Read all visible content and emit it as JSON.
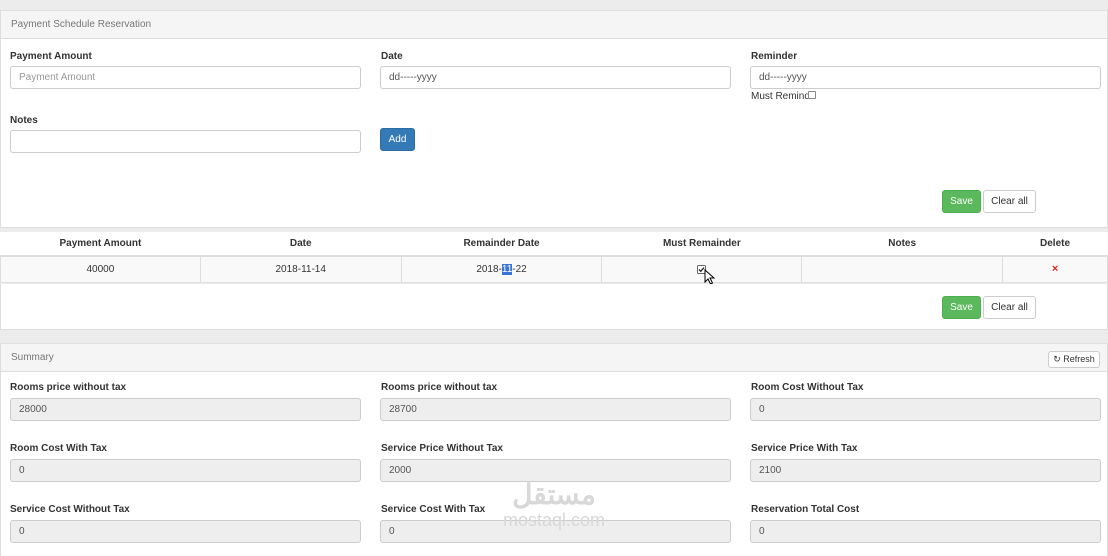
{
  "schedule": {
    "title": "Payment Schedule Reservation",
    "payment_amount_label": "Payment Amount",
    "payment_amount_placeholder": "Payment Amount",
    "date_label": "Date",
    "date_placeholder": "dd-----yyyy",
    "reminder_label": "Reminder",
    "reminder_placeholder": "dd-----yyyy",
    "must_remind_label": "Must Remind",
    "notes_label": "Notes",
    "notes_value": "",
    "add_label": "Add",
    "save_label": "Save",
    "clear_label": "Clear all"
  },
  "table": {
    "headers": [
      "Payment Amount",
      "Date",
      "Remainder Date",
      "Must Remainder",
      "Notes",
      "Delete"
    ],
    "rows": [
      {
        "amount": "40000",
        "date": "2018-11-14",
        "remainder_pre": "2018-",
        "remainder_sel": "11",
        "remainder_post": "-22",
        "must_remainder": true,
        "notes": "",
        "delete_icon": "×"
      }
    ]
  },
  "bottom_actions": {
    "save_label": "Save",
    "clear_label": "Clear all"
  },
  "summary": {
    "title": "Summary",
    "refresh_label": "Refresh",
    "fields": [
      {
        "label": "Rooms price without tax",
        "value": "28000"
      },
      {
        "label": "Rooms price without tax",
        "value": "28700"
      },
      {
        "label": "Room Cost Without Tax",
        "value": "0"
      },
      {
        "label": "Room Cost With Tax",
        "value": "0"
      },
      {
        "label": "Service Price Without Tax",
        "value": "2000"
      },
      {
        "label": "Service Price With Tax",
        "value": "2100"
      },
      {
        "label": "Service Cost Without Tax",
        "value": "0"
      },
      {
        "label": "Service Cost With Tax",
        "value": "0"
      },
      {
        "label": "Reservation Total Cost",
        "value": "0"
      }
    ]
  },
  "watermark": {
    "arabic": "مستقل",
    "latin": "mostaql.com"
  },
  "colors": {
    "primary": "#337ab7",
    "success": "#5cb85c",
    "danger": "#d9261c",
    "selection": "#3875d7"
  }
}
